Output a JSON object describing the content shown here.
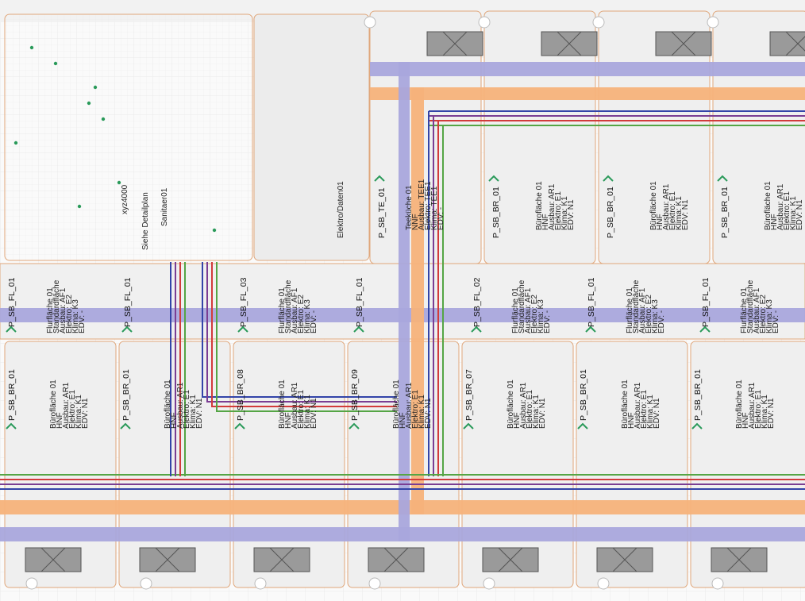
{
  "colors": {
    "duct_purple": "#a9a6dc",
    "duct_orange": "#f6b27a",
    "line_red": "#d23b3b",
    "line_blue": "#3344a8",
    "line_green": "#55a545",
    "line_violet": "#7a3d93",
    "room_bg": "#eeeeee",
    "room_edge": "#e0a77b",
    "marker_green": "#2a9a5a",
    "marker_cyan": "#3ec2c9"
  },
  "rooms": {
    "upper": [
      {
        "code": "P_SB_TE_01",
        "lines": [
          "Teeküche 01",
          "NNF",
          "Ausbau: TEE1",
          "Elektro: TEE1",
          "Klima: TEE1",
          "EDV: -"
        ]
      },
      {
        "code": "P_SB_BR_01",
        "lines": [
          "Bürofläche 01",
          "HNF",
          "Ausbau: AR1",
          "Elektro: E1",
          "Klima: K1",
          "EDV: N1"
        ]
      },
      {
        "code": "P_SB_BR_01",
        "lines": [
          "Bürofläche 01",
          "HNF",
          "Ausbau: AR1",
          "Elektro: E1",
          "Klima: K1",
          "EDV: N1"
        ]
      },
      {
        "code": "P_SB_BR_01",
        "lines": [
          "Bürofläche 01",
          "HNF",
          "Ausbau: AR1",
          "Elektro: E1",
          "Klima: K1",
          "EDV: N1"
        ]
      }
    ],
    "upper_left_labels": [
      "xyz4000",
      "Siehe Detailplan",
      "Sanitaer01",
      "Elektro/Daten01"
    ],
    "corridor": [
      {
        "code": "P_SB_FL_01",
        "lines": [
          "Flurfläche 01",
          "Standardfläche",
          "Ausbau: AF1",
          "Elektro: E2",
          "Klima: K3",
          "EDV: -"
        ]
      },
      {
        "code": "P_SB_FL_01",
        "lines": []
      },
      {
        "code": "P_SB_FL_03",
        "lines": [
          "Flurfläche 01",
          "Standardfläche",
          "Ausbau: AF1",
          "Elektro: E2",
          "Klima: K3",
          "EDV: -"
        ]
      },
      {
        "code": "P_SB_FL_01",
        "lines": []
      },
      {
        "code": "P_SB_FL_02",
        "lines": [
          "Flurfläche 01",
          "Standardfläche",
          "Ausbau: AF1",
          "Elektro: E2",
          "Klima: K3",
          "EDV: -"
        ]
      },
      {
        "code": "P_SB_FL_01",
        "lines": [
          "Flurfläche 01",
          "Standardfläche",
          "Ausbau: AF1",
          "Elektro: E2",
          "Klima: K3",
          "EDV: -"
        ]
      },
      {
        "code": "P_SB_FL_01",
        "lines": [
          "Flurfläche 01",
          "Standardfläche",
          "Ausbau: AF1",
          "Elektro: E2",
          "Klima: K3",
          "EDV: -"
        ]
      }
    ],
    "lower": [
      {
        "code": "P_SB_BR_01",
        "lines": [
          "Bürofläche 01",
          "HNF",
          "Ausbau: AR1",
          "Elektro: E1",
          "Klima: K1",
          "EDV: N1"
        ]
      },
      {
        "code": "P_SB_BR_01",
        "lines": [
          "Bürofläche 01",
          "HNF",
          "Ausbau: AR1",
          "Elektro: E1",
          "Klima: K1",
          "EDV: N1"
        ]
      },
      {
        "code": "P_SB_BR_08",
        "lines": [
          "Bürofläche 01",
          "HNF",
          "Ausbau: AR1",
          "Elektro: E1",
          "Klima: K1",
          "EDV: N1"
        ]
      },
      {
        "code": "P_SB_BR_09",
        "lines": [
          "Bürofläche 01",
          "HNF",
          "Ausbau: AR1",
          "Elektro: E1",
          "Klima: K1",
          "EDV: N1"
        ]
      },
      {
        "code": "P_SB_BR_07",
        "lines": [
          "Bürofläche 01",
          "HNF",
          "Ausbau: AR1",
          "Elektro: E1",
          "Klima: K1",
          "EDV: N1"
        ]
      },
      {
        "code": "P_SB_BR_01",
        "lines": [
          "Bürofläche 01",
          "HNF",
          "Ausbau: AR1",
          "Elektro: E1",
          "Klima: K1",
          "EDV: N1"
        ]
      },
      {
        "code": "P_SB_BR_01",
        "lines": [
          "Bürofläche 01",
          "HNF",
          "Ausbau: AR1",
          "Elektro: E1",
          "Klima: K1",
          "EDV: N1"
        ]
      }
    ]
  }
}
